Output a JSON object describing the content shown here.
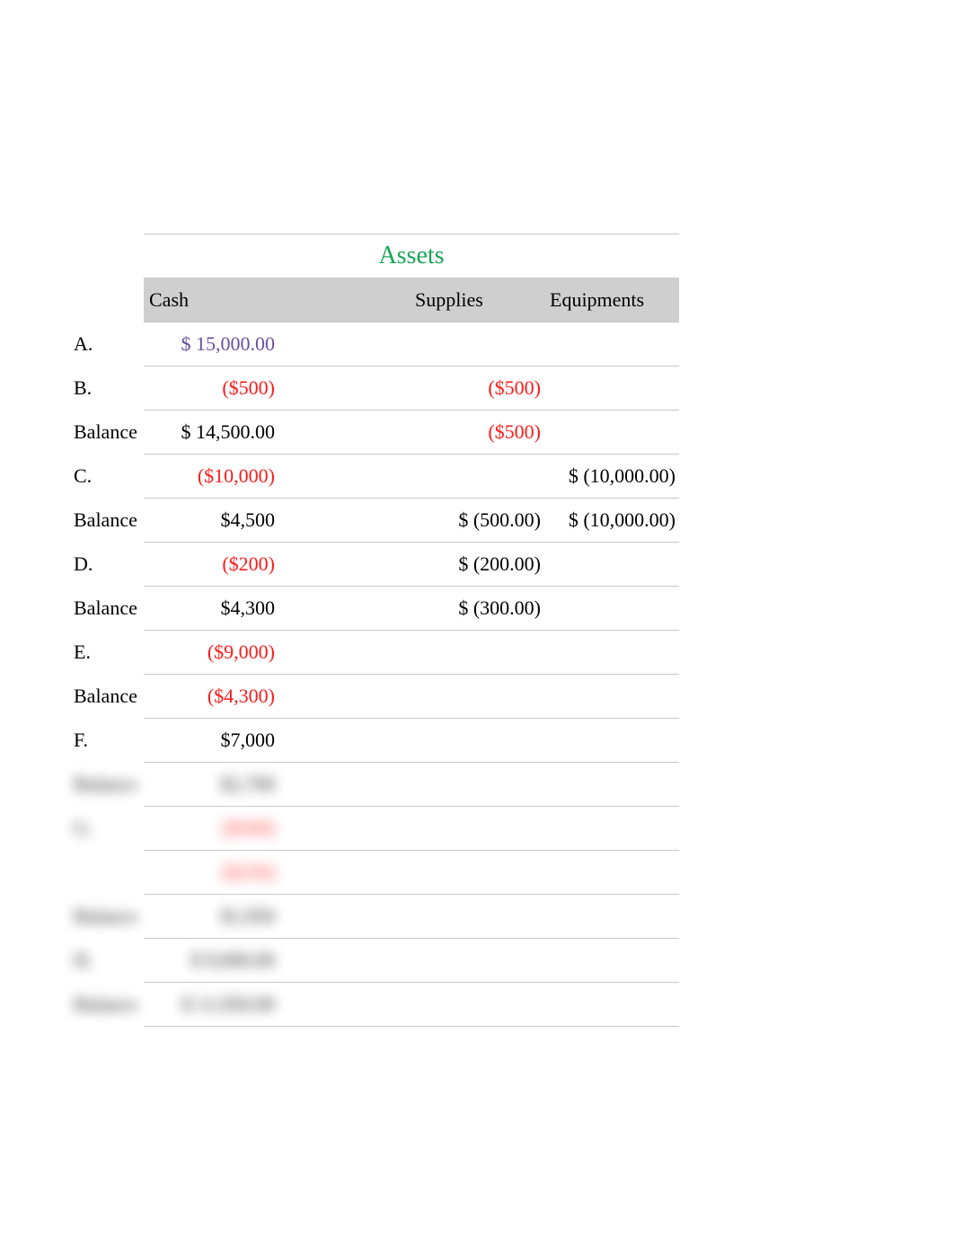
{
  "header": {
    "assets": "Assets",
    "cash": "Cash",
    "supplies": "Supplies",
    "equipments": "Equipments"
  },
  "rows": [
    {
      "label": "A.",
      "cash": "$   15,000.00",
      "cash_cls": "purp",
      "supp": "",
      "eq": ""
    },
    {
      "label": "B.",
      "cash": "($500)",
      "cash_cls": "neg",
      "supp": "($500)",
      "supp_cls": "neg",
      "eq": ""
    },
    {
      "label": "Balance",
      "cash": "$   14,500.00",
      "cash_cls": "",
      "supp": "($500)",
      "supp_cls": "neg",
      "eq": ""
    },
    {
      "label": "C.",
      "cash": "($10,000)",
      "cash_cls": "neg",
      "supp": "",
      "eq": "$ (10,000.00)"
    },
    {
      "label": "Balance",
      "cash": "$4,500",
      "cash_cls": "",
      "supp": "$     (500.00)",
      "eq": "$ (10,000.00)"
    },
    {
      "label": "D.",
      "cash": "($200)",
      "cash_cls": "neg",
      "supp": "$     (200.00)",
      "eq": ""
    },
    {
      "label": "Balance",
      "cash": "$4,300",
      "cash_cls": "",
      "supp": "$     (300.00)",
      "eq": ""
    },
    {
      "label": "E.",
      "cash": "($9,000)",
      "cash_cls": "neg",
      "supp": "",
      "eq": ""
    },
    {
      "label": "Balance",
      "cash": "($4,300)",
      "cash_cls": "neg",
      "supp": "",
      "eq": ""
    },
    {
      "label": "F.",
      "cash": "$7,000",
      "cash_cls": "",
      "supp": "",
      "eq": ""
    }
  ],
  "blurred_rows": [
    {
      "label": "Balance",
      "cash": "$2,700",
      "cash_cls": ""
    },
    {
      "label": "G.",
      "cash": "($500)",
      "cash_cls": "neg"
    },
    {
      "label": "",
      "cash": "($250)",
      "cash_cls": "neg"
    },
    {
      "label": "Balance",
      "cash": "$1,950",
      "cash_cls": ""
    },
    {
      "label": "H.",
      "cash": "$   9,000.00",
      "cash_cls": ""
    },
    {
      "label": "Balance",
      "cash": "$ 11,950.00",
      "cash_cls": ""
    }
  ]
}
